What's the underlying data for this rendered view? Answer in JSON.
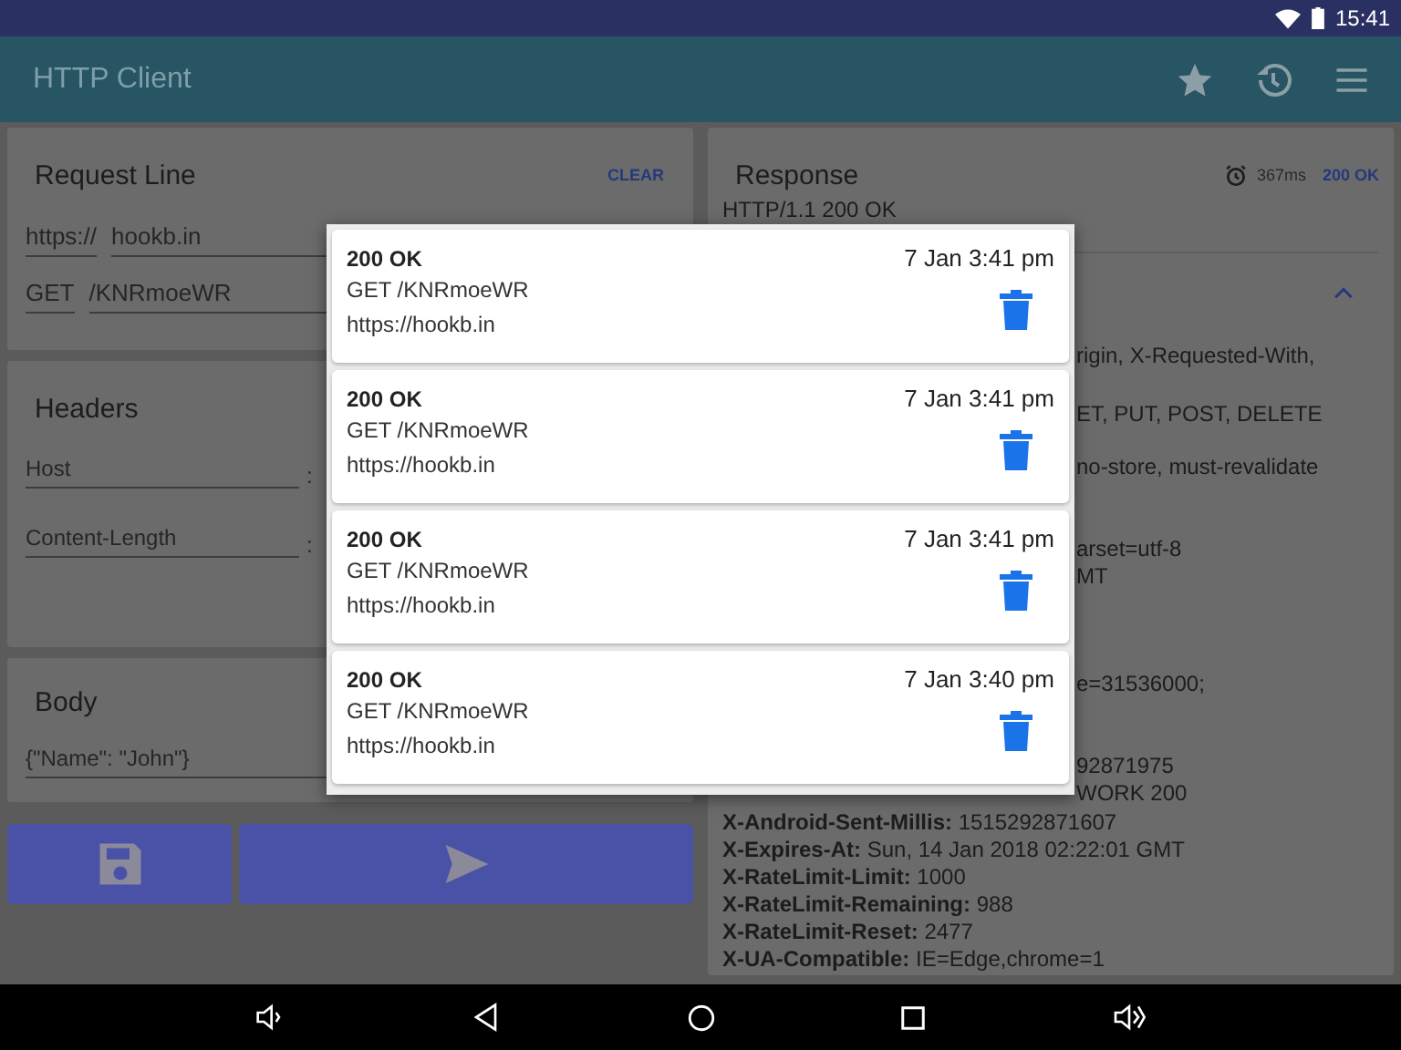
{
  "status_bar": {
    "time": "15:41"
  },
  "app_bar": {
    "title": "HTTP Client"
  },
  "request_line": {
    "title": "Request Line",
    "clear_label": "CLEAR",
    "scheme": "https://",
    "host": "hookb.in",
    "method": "GET",
    "path": "/KNRmoeWR"
  },
  "headers": {
    "title": "Headers",
    "rows": [
      {
        "name": "Host",
        "separator": ":"
      },
      {
        "name": "Content-Length",
        "separator": ":"
      }
    ]
  },
  "body": {
    "title": "Body",
    "value": "{\"Name\": \"John\"}"
  },
  "response": {
    "title": "Response",
    "duration": "367ms",
    "status": "200 OK",
    "status_line": "HTTP/1.1 200 OK",
    "fragments": [
      "rigin, X-Requested-With,",
      "ET, PUT, POST, DELETE",
      "no-store, must-revalidate",
      "arset=utf-8",
      "MT",
      "e=31536000;",
      "92871975",
      "WORK 200"
    ],
    "headers": [
      {
        "name": "X-Android-Sent-Millis:",
        "value": "1515292871607"
      },
      {
        "name": "X-Expires-At:",
        "value": "Sun, 14 Jan 2018 02:22:01 GMT"
      },
      {
        "name": "X-RateLimit-Limit:",
        "value": "1000"
      },
      {
        "name": "X-RateLimit-Remaining:",
        "value": "988"
      },
      {
        "name": "X-RateLimit-Reset:",
        "value": "2477"
      },
      {
        "name": "X-UA-Compatible:",
        "value": "IE=Edge,chrome=1"
      }
    ]
  },
  "history_dialog": {
    "entries": [
      {
        "status": "200 OK",
        "date": "7 Jan 3:41 pm",
        "request": "GET /KNRmoeWR",
        "url": "https://hookb.in"
      },
      {
        "status": "200 OK",
        "date": "7 Jan 3:41 pm",
        "request": "GET /KNRmoeWR",
        "url": "https://hookb.in"
      },
      {
        "status": "200 OK",
        "date": "7 Jan 3:41 pm",
        "request": "GET /KNRmoeWR",
        "url": "https://hookb.in"
      },
      {
        "status": "200 OK",
        "date": "7 Jan 3:40 pm",
        "request": "GET /KNRmoeWR",
        "url": "https://hookb.in"
      }
    ]
  }
}
